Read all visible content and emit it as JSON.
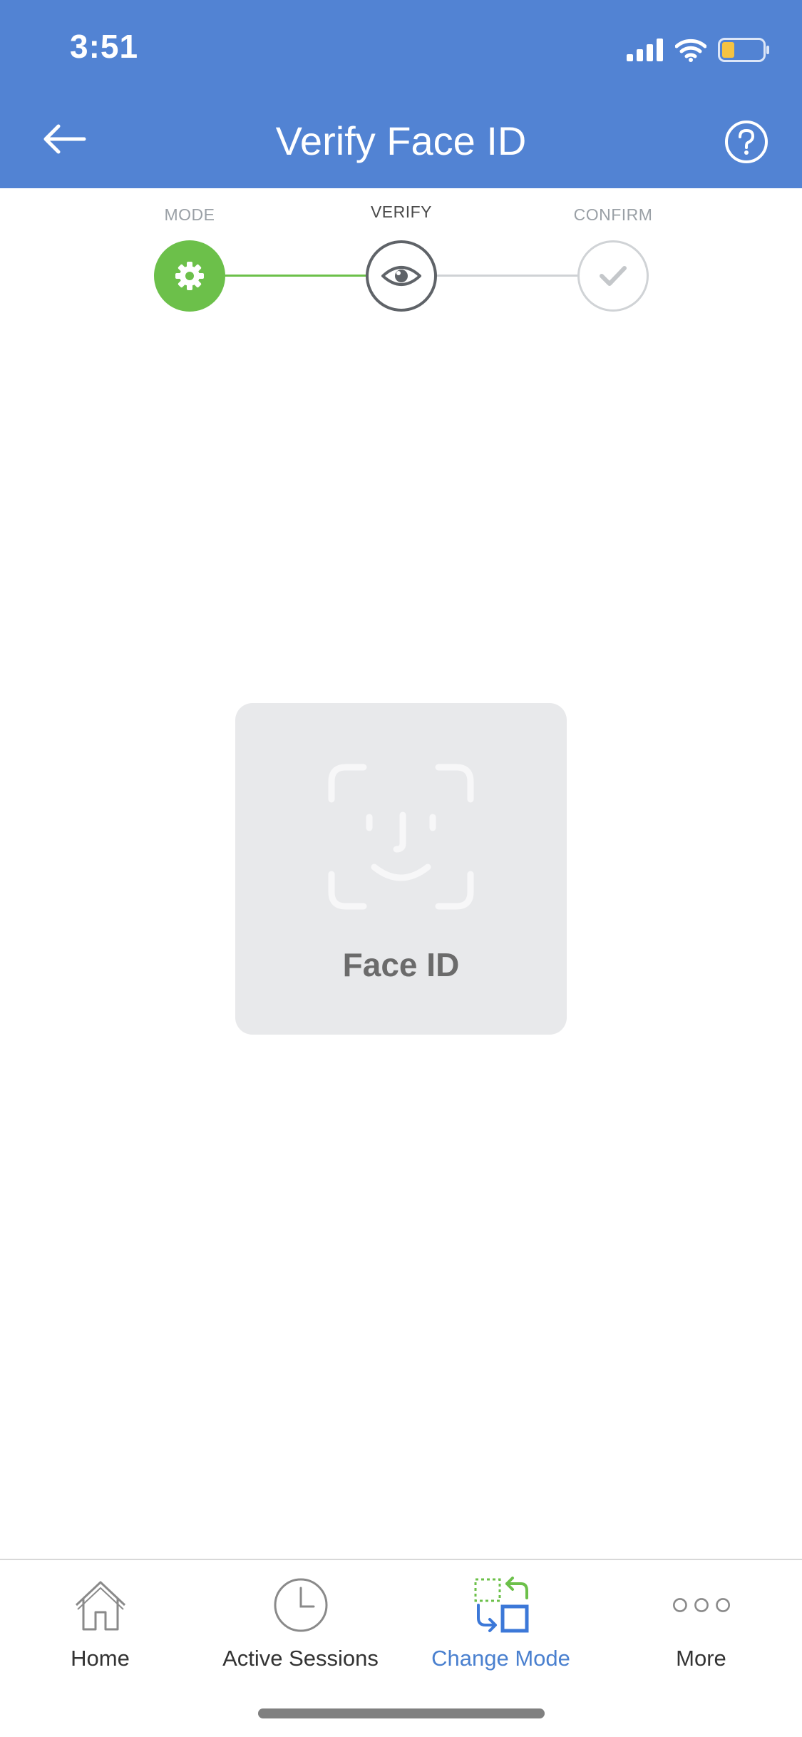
{
  "status_bar": {
    "time": "3:51",
    "icons": [
      "signal-icon",
      "wifi-icon",
      "battery-icon"
    ],
    "battery_color": "#f5c342"
  },
  "nav": {
    "title": "Verify Face ID",
    "back_icon": "arrow-left-icon",
    "help_icon": "help-circle-icon"
  },
  "stepper": {
    "steps": [
      {
        "label": "MODE",
        "state": "complete",
        "icon": "gear-icon"
      },
      {
        "label": "VERIFY",
        "state": "current",
        "icon": "eye-icon"
      },
      {
        "label": "CONFIRM",
        "state": "pending",
        "icon": "check-icon"
      }
    ]
  },
  "faceid": {
    "label": "Face ID",
    "icon": "face-id-icon"
  },
  "tabbar": {
    "tabs": [
      {
        "label": "Home",
        "icon": "home-icon",
        "active": false
      },
      {
        "label": "Active Sessions",
        "icon": "clock-icon",
        "active": false
      },
      {
        "label": "Change Mode",
        "icon": "change-mode-icon",
        "active": true
      },
      {
        "label": "More",
        "icon": "more-dots-icon",
        "active": false
      }
    ]
  },
  "colors": {
    "header": "#5283d3",
    "step_complete": "#6cc04a",
    "active_tab": "#4a80cf"
  }
}
